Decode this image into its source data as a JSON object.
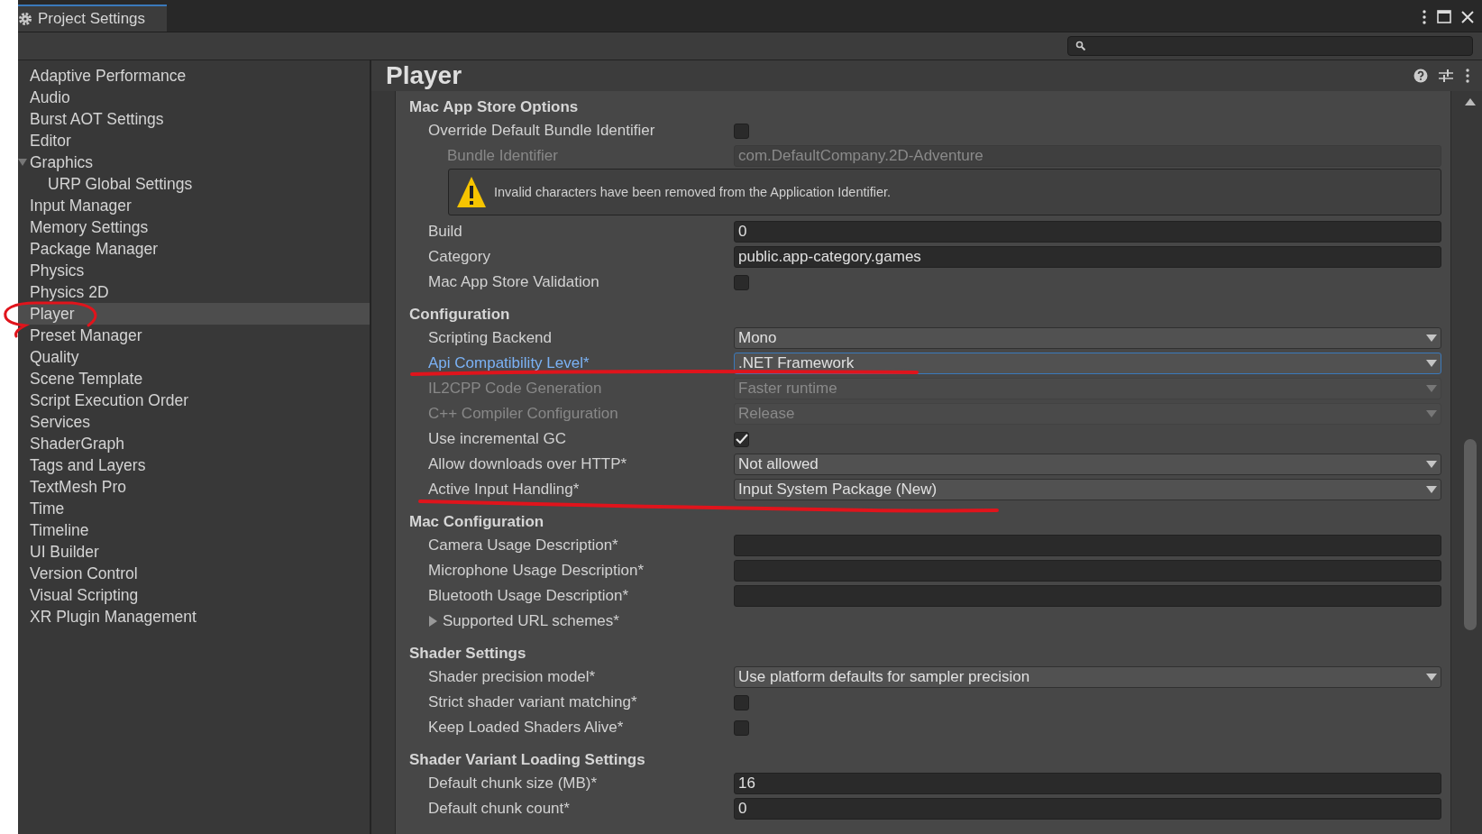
{
  "window": {
    "tab_title": "Project Settings"
  },
  "sidebar": {
    "items": [
      {
        "label": "Adaptive Performance",
        "selected": false
      },
      {
        "label": "Audio",
        "selected": false
      },
      {
        "label": "Burst AOT Settings",
        "selected": false
      },
      {
        "label": "Editor",
        "selected": false
      },
      {
        "label": "Graphics",
        "selected": false,
        "expanded": true,
        "children": [
          {
            "label": "URP Global Settings",
            "selected": false
          }
        ]
      },
      {
        "label": "Input Manager",
        "selected": false
      },
      {
        "label": "Memory Settings",
        "selected": false
      },
      {
        "label": "Package Manager",
        "selected": false
      },
      {
        "label": "Physics",
        "selected": false
      },
      {
        "label": "Physics 2D",
        "selected": false
      },
      {
        "label": "Player",
        "selected": true
      },
      {
        "label": "Preset Manager",
        "selected": false
      },
      {
        "label": "Quality",
        "selected": false
      },
      {
        "label": "Scene Template",
        "selected": false
      },
      {
        "label": "Script Execution Order",
        "selected": false
      },
      {
        "label": "Services",
        "selected": false
      },
      {
        "label": "ShaderGraph",
        "selected": false
      },
      {
        "label": "Tags and Layers",
        "selected": false
      },
      {
        "label": "TextMesh Pro",
        "selected": false
      },
      {
        "label": "Time",
        "selected": false
      },
      {
        "label": "Timeline",
        "selected": false
      },
      {
        "label": "UI Builder",
        "selected": false
      },
      {
        "label": "Version Control",
        "selected": false
      },
      {
        "label": "Visual Scripting",
        "selected": false
      },
      {
        "label": "XR Plugin Management",
        "selected": false
      }
    ]
  },
  "panel": {
    "title": "Player",
    "rows": [
      {
        "kind": "header",
        "label": "Mac App Store Options"
      },
      {
        "kind": "checkbox",
        "label": "Override Default Bundle Identifier",
        "checked": false
      },
      {
        "kind": "text",
        "label": "Bundle Identifier",
        "value": "com.DefaultCompany.2D-Adventure",
        "disabled": true,
        "indented": true
      },
      {
        "kind": "warning",
        "text": "Invalid characters have been removed from the Application Identifier."
      },
      {
        "kind": "text",
        "label": "Build",
        "value": "0"
      },
      {
        "kind": "text",
        "label": "Category",
        "value": "public.app-category.games"
      },
      {
        "kind": "checkbox",
        "label": "Mac App Store Validation",
        "checked": false
      },
      {
        "kind": "header",
        "label": "Configuration"
      },
      {
        "kind": "dropdown",
        "label": "Scripting Backend",
        "value": "Mono"
      },
      {
        "kind": "dropdown",
        "label": "Api Compatibility Level*",
        "value": ".NET Framework",
        "focused": true
      },
      {
        "kind": "dropdown",
        "label": "IL2CPP Code Generation",
        "value": "Faster runtime",
        "disabled": true
      },
      {
        "kind": "dropdown",
        "label": "C++ Compiler Configuration",
        "value": "Release",
        "disabled": true
      },
      {
        "kind": "checkbox",
        "label": "Use incremental GC",
        "checked": true
      },
      {
        "kind": "dropdown",
        "label": "Allow downloads over HTTP*",
        "value": "Not allowed"
      },
      {
        "kind": "dropdown",
        "label": "Active Input Handling*",
        "value": "Input System Package (New)"
      },
      {
        "kind": "header",
        "label": "Mac Configuration"
      },
      {
        "kind": "text",
        "label": "Camera Usage Description*"
      },
      {
        "kind": "text",
        "label": "Microphone Usage Description*"
      },
      {
        "kind": "text",
        "label": "Bluetooth Usage Description*"
      },
      {
        "kind": "foldout",
        "label": "Supported URL schemes*",
        "expanded": false
      },
      {
        "kind": "header",
        "label": "Shader Settings"
      },
      {
        "kind": "dropdown",
        "label": "Shader precision model*",
        "value": "Use platform defaults for sampler precision"
      },
      {
        "kind": "checkbox",
        "label": "Strict shader variant matching*",
        "checked": false
      },
      {
        "kind": "checkbox",
        "label": "Keep Loaded Shaders Alive*",
        "checked": false
      },
      {
        "kind": "header",
        "label": "Shader Variant Loading Settings"
      },
      {
        "kind": "text",
        "label": "Default chunk size (MB)*",
        "value": "16"
      },
      {
        "kind": "text",
        "label": "Default chunk count*",
        "value": "0"
      }
    ]
  }
}
